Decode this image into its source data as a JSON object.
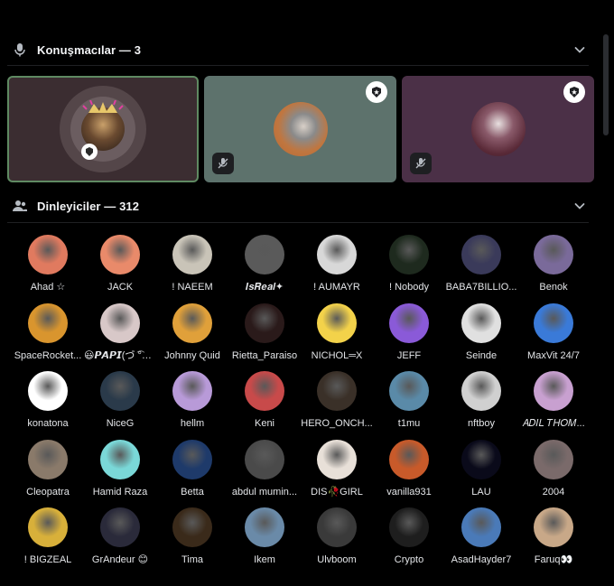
{
  "speakers": {
    "title": "Konuşmacılar — 3",
    "tiles": [
      {
        "bg": "#3b2d31",
        "active": true,
        "avatar": "#3a2a22",
        "ring": "#4a3a3e"
      },
      {
        "bg": "#5d726c",
        "active": false,
        "avatar": "#c0763f",
        "badge": "star-badge-icon",
        "muted": true
      },
      {
        "bg": "#4b3047",
        "active": false,
        "avatar": "#6b2c38",
        "badge": "star-badge-icon",
        "muted": true
      }
    ]
  },
  "listeners": {
    "title": "Dinleyiciler — 312",
    "items": [
      {
        "name": "Ahad ☆",
        "color": "#e07a5f"
      },
      {
        "name": "JACK",
        "color": "#e98a6a"
      },
      {
        "name": "! NAEEM",
        "color": "#c9c4b8"
      },
      {
        "name": "𝑰𝒔𝑹𝒆𝒂𝒍✦",
        "color": "#5a5a5a"
      },
      {
        "name": "! AUMAYR",
        "color": "#d8d8d8"
      },
      {
        "name": "! Nobody",
        "color": "#1e2a1e"
      },
      {
        "name": "BABA7BILLIO...",
        "color": "#3a3a5a"
      },
      {
        "name": "Benok",
        "color": "#7a6a9a"
      },
      {
        "name": "SpaceRocket...",
        "color": "#d9952e"
      },
      {
        "name": "😃𝙋𝘼𝙋𝙄(づ ͡°ʖ ͡°)",
        "color": "#d8c8c8"
      },
      {
        "name": "Johnny Quid",
        "color": "#e0a03a"
      },
      {
        "name": "Rietta_Paraiso",
        "color": "#2a1a1a"
      },
      {
        "name": "NICHOL═X",
        "color": "#f3d24a"
      },
      {
        "name": "JEFF",
        "color": "#8a5ad8"
      },
      {
        "name": "Seinde",
        "color": "#e0e0e0"
      },
      {
        "name": "MaxVit 24/7",
        "color": "#3a7ad8"
      },
      {
        "name": "konatona",
        "color": "#ffffff"
      },
      {
        "name": "NiceG",
        "color": "#2a3a4a"
      },
      {
        "name": "hellm",
        "color": "#b89ad8"
      },
      {
        "name": "Keni",
        "color": "#c84a4a"
      },
      {
        "name": "HERO_ONCH...",
        "color": "#3a3028"
      },
      {
        "name": "t1mu",
        "color": "#5a8aa8"
      },
      {
        "name": "nftboy",
        "color": "#d0d0d0"
      },
      {
        "name": "𝐴𝐷𝐼𝐿 𝑇𝐻𝑂𝑀...",
        "color": "#c8a0d0"
      },
      {
        "name": "Cleopatra",
        "color": "#8a7a6a"
      },
      {
        "name": "Hamid Raza",
        "color": "#7ad8d8"
      },
      {
        "name": "Betta",
        "color": "#1e3a6a"
      },
      {
        "name": "abdul mumin...",
        "color": "#4a4a4a"
      },
      {
        "name": "DIS🥀GIRL",
        "color": "#e8e0d8"
      },
      {
        "name": "vanilla931",
        "color": "#c85a2a"
      },
      {
        "name": "LAU",
        "color": "#0a0a1a"
      },
      {
        "name": "2004",
        "color": "#7a6a6a"
      },
      {
        "name": "! BIGZEAL",
        "color": "#d8b03a"
      },
      {
        "name": "GrAndeur 😊",
        "color": "#2a2a3a"
      },
      {
        "name": "Tima",
        "color": "#3a2a1a"
      },
      {
        "name": "Ikem",
        "color": "#6a8aa8"
      },
      {
        "name": "Ulvboom",
        "color": "#3a3a3a"
      },
      {
        "name": "Crypto",
        "color": "#1e1e1e"
      },
      {
        "name": "AsadHayder7",
        "color": "#4a7ab8"
      },
      {
        "name": "Faruq👀",
        "color": "#c8a888"
      }
    ]
  }
}
